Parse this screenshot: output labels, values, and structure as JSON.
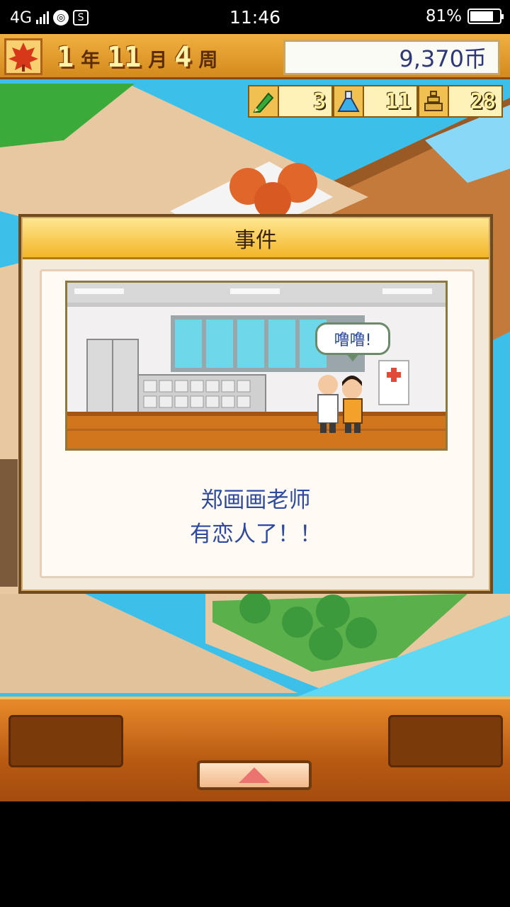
{
  "status_bar": {
    "network": "4G",
    "time": "11:46",
    "battery": "81%",
    "battery_level": 0.81,
    "icons": [
      "signal-icon",
      "globe-icon",
      "s-app-icon",
      "battery-icon"
    ]
  },
  "hud": {
    "season_icon": "maple-leaf-icon",
    "year": "1",
    "year_unit": "年",
    "month": "11",
    "month_unit": "月",
    "week": "4",
    "week_unit": "周",
    "money": "9,370币"
  },
  "resources": [
    {
      "icon": "pencil-icon",
      "value": "3"
    },
    {
      "icon": "flask-icon",
      "value": "11"
    },
    {
      "icon": "tower-icon",
      "value": "28"
    }
  ],
  "event_dialog": {
    "title": "事件",
    "speech": "噜噜!",
    "message_line1": "郑画画老师",
    "message_line2": "有恋人了！！"
  },
  "bottom_panel": {
    "up_button_icon": "triangle-up-icon"
  }
}
